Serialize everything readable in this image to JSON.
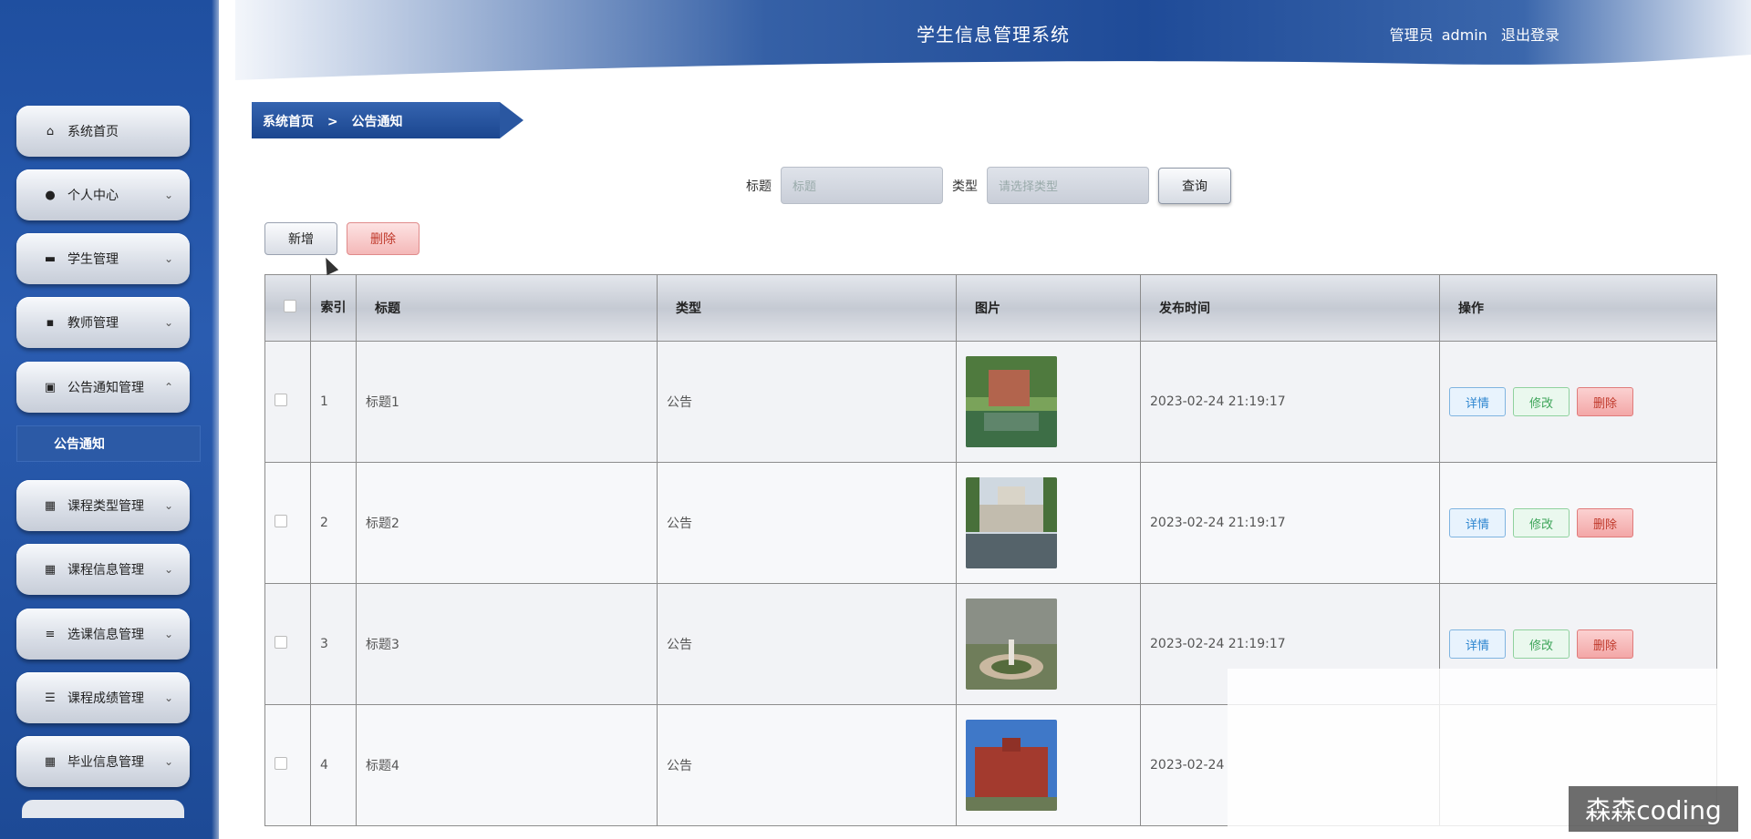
{
  "header": {
    "title": "学生信息管理系统",
    "user_role": "管理员",
    "username": "admin",
    "logout": "退出登录"
  },
  "sidebar": {
    "items": [
      {
        "label": "系统首页",
        "icon": "home-icon"
      },
      {
        "label": "个人中心",
        "icon": "user-icon"
      },
      {
        "label": "学生管理",
        "icon": "briefcase-icon"
      },
      {
        "label": "教师管理",
        "icon": "teacher-icon"
      },
      {
        "label": "公告通知管理",
        "icon": "clipboard-icon"
      },
      {
        "label": "课程类型管理",
        "icon": "grid-icon"
      },
      {
        "label": "课程信息管理",
        "icon": "grid-icon"
      },
      {
        "label": "选课信息管理",
        "icon": "sliders-icon"
      },
      {
        "label": "课程成绩管理",
        "icon": "list-icon"
      },
      {
        "label": "毕业信息管理",
        "icon": "grid-icon"
      }
    ],
    "sub_item": "公告通知"
  },
  "breadcrumb": {
    "home": "系统首页",
    "separator": ">",
    "current": "公告通知"
  },
  "search": {
    "title_label": "标题",
    "title_placeholder": "标题",
    "type_label": "类型",
    "type_placeholder": "请选择类型",
    "query_button": "查询"
  },
  "actions": {
    "add_button": "新增",
    "delete_button": "删除"
  },
  "table": {
    "columns": [
      "索引",
      "标题",
      "类型",
      "图片",
      "发布时间",
      "操作"
    ],
    "rows": [
      {
        "index": "1",
        "title": "标题1",
        "type": "公告",
        "published": "2023-02-24 21:19:17"
      },
      {
        "index": "2",
        "title": "标题2",
        "type": "公告",
        "published": "2023-02-24 21:19:17"
      },
      {
        "index": "3",
        "title": "标题3",
        "type": "公告",
        "published": "2023-02-24 21:19:17"
      },
      {
        "index": "4",
        "title": "标题4",
        "type": "公告",
        "published": "2023-02-24"
      }
    ],
    "row_actions": {
      "detail": "详情",
      "edit": "修改",
      "delete": "删除"
    }
  },
  "watermark": "森森coding",
  "colors": {
    "sidebar_blue": "#2a5cb0",
    "header_blue": "#1f4b98",
    "detail": "#2e86d0",
    "edit": "#3ea55a",
    "delete": "#c0392b"
  }
}
